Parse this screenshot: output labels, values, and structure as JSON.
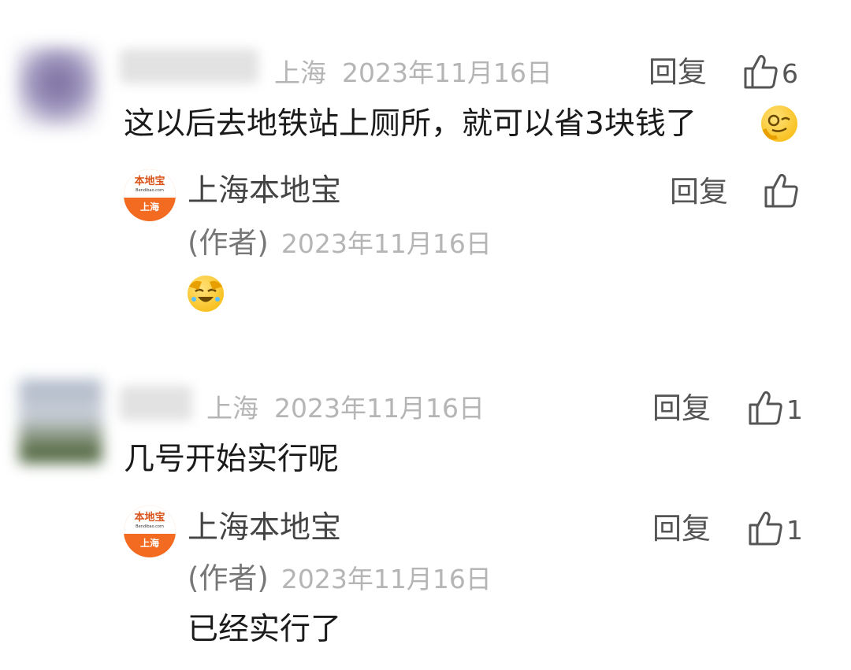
{
  "icons": {
    "like": "thumbs-up-icon",
    "reply": "reply-text"
  },
  "colors": {
    "meta_gray": "#b5b5b5",
    "logo_orange": "#f26b21",
    "emoji_yellow": "#f7b500"
  },
  "comments": [
    {
      "location": "上海",
      "date": "2023年11月16日",
      "text": "这以后去地铁站上厕所，就可以省3块钱了",
      "emoji": "smirking-monocle-face",
      "reply_label": "回复",
      "likes": "6",
      "author_reply": {
        "logo_brand": "本地宝",
        "logo_site": "Bendibao.com",
        "logo_city": "上海",
        "name": "上海本地宝",
        "tag": "(作者)",
        "date": "2023年11月16日",
        "reply_label": "回复",
        "emoji": "facepalm-laughing-face"
      }
    },
    {
      "location": "上海",
      "date": "2023年11月16日",
      "text": "几号开始实行呢",
      "reply_label": "回复",
      "likes": "1",
      "author_reply": {
        "logo_brand": "本地宝",
        "logo_site": "Bendibao.com",
        "logo_city": "上海",
        "name": "上海本地宝",
        "tag": "(作者)",
        "date": "2023年11月16日",
        "text": "已经实行了",
        "reply_label": "回复",
        "likes": "1"
      }
    }
  ]
}
